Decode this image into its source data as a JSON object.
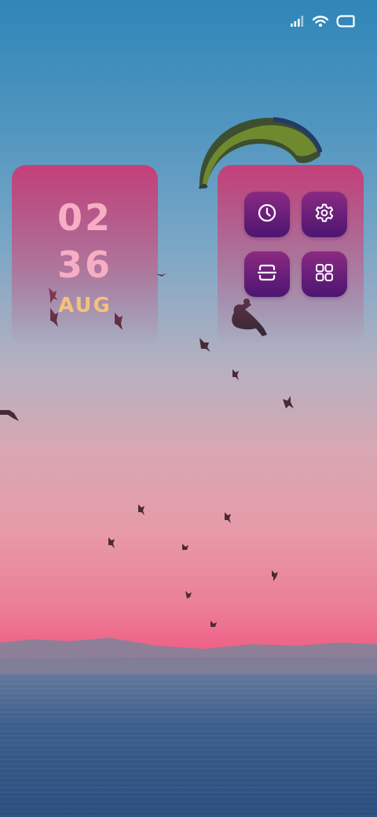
{
  "status_bar": {
    "icons": [
      "signal-icon",
      "wifi-icon",
      "battery-icon"
    ]
  },
  "clock_widget": {
    "hour": "02",
    "minute": "36",
    "month": "AUG",
    "colors": {
      "digits": "#f7aec4",
      "month": "#f4c27c"
    }
  },
  "shortcuts": [
    {
      "icon": "clock-icon"
    },
    {
      "icon": "gear-icon"
    },
    {
      "icon": "scan-icon"
    },
    {
      "icon": "apps-grid-icon"
    }
  ],
  "colors": {
    "widget_bg": "#cd3773",
    "shortcut_bg": "#6a1f7a"
  }
}
